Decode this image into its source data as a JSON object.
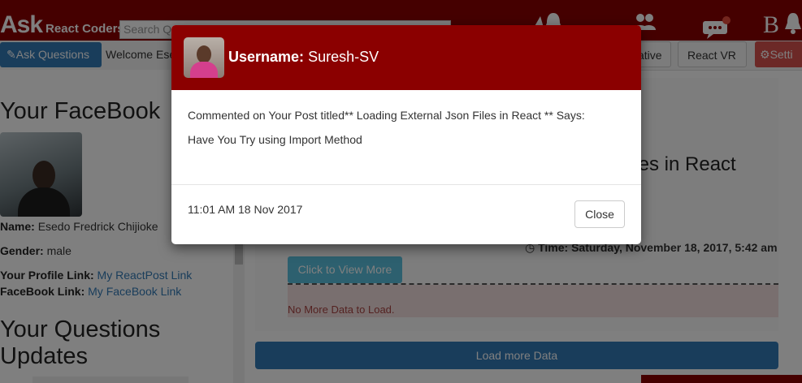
{
  "header": {
    "brand_big": "Ask",
    "brand_small": "React Coders",
    "search_text": "Search Q",
    "icons": [
      "bell-icon",
      "users-icon",
      "chat-icon",
      "blog-icon",
      "bell-icon"
    ],
    "blog_letter": "B"
  },
  "subnav": {
    "ask_label": "Ask Questions",
    "welcome": "Welcome Ese",
    "native_label": "ative",
    "react_vr_label": "React VR",
    "settings_label": "Setti"
  },
  "sidebar": {
    "facebook_heading": "Your FaceBook",
    "name_label": "Name:",
    "name_value": "Esedo Fredrick Chijioke",
    "gender_label": "Gender:",
    "gender_value": "male",
    "profile_label": "Your Profile Link:",
    "profile_link": "My ReactPost Link",
    "facebook_label": "FaceBook Link:",
    "facebook_link": "My FaceBook Link",
    "questions_heading_1": "Your Questions",
    "questions_heading_2": "Updates"
  },
  "main": {
    "post_title_fragment": "iles in React",
    "time_text": "Time: Saturday, November 18, 2017, 5:42 am",
    "view_more_label": "Click to View More",
    "no_more_text": "No More Data to Load.",
    "load_more_label": "Load more Data"
  },
  "modal": {
    "username_label": "Username:",
    "username_value": "Suresh-SV",
    "line1": "Commented on Your Post titled** Loading External Json Files in React ** Says:",
    "line2": "Have You Try using Import Method",
    "timestamp": "11:01 AM 18 Nov 2017",
    "close_label": "Close"
  },
  "colors": {
    "brand_red": "#8b0000",
    "primary_blue": "#337ab7",
    "info_blue": "#5bc0de",
    "danger_red": "#d9534f"
  }
}
